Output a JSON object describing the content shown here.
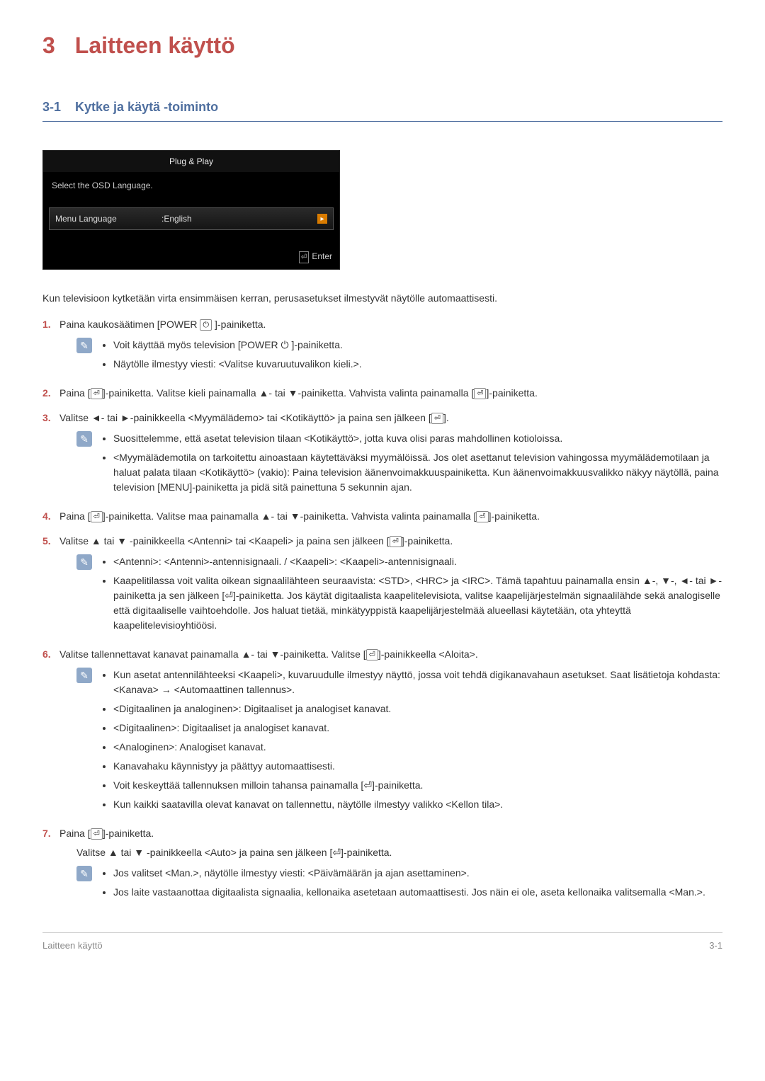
{
  "heading": {
    "num": "3",
    "title": "Laitteen käyttö"
  },
  "section": {
    "num": "3-1",
    "title": "Kytke ja käytä -toiminto"
  },
  "osd": {
    "title": "Plug & Play",
    "prompt": "Select the OSD Language.",
    "row_label": "Menu Language",
    "row_value": ":English",
    "enter_label": "Enter"
  },
  "intro": "Kun televisioon kytketään virta ensimmäisen kerran, perusasetukset ilmestyvät näytölle automaattisesti.",
  "glyphs": {
    "enter": "⏎",
    "power": "⏻",
    "up": "▲",
    "down": "▼",
    "left": "◄",
    "right": "►"
  },
  "steps": [
    {
      "text_parts": [
        "Paina kaukosäätimen [POWER ",
        "⏻",
        " ]-painiketta."
      ],
      "note": [
        "Voit käyttää myös television [POWER ⏻ ]-painiketta.",
        "Näytölle ilmestyy viesti: <Valitse kuvaruutuvalikon kieli.>."
      ]
    },
    {
      "text_parts": [
        "Paina [",
        "⏎",
        "]-painiketta. Valitse kieli painamalla ▲- tai ▼-painiketta. Vahvista valinta painamalla [",
        "⏎",
        "]-painiketta."
      ]
    },
    {
      "text_parts": [
        "Valitse ◄- tai ►-painikkeella <Myymälädemo> tai <Kotikäyttö> ja paina sen jälkeen [",
        "⏎",
        "]."
      ],
      "note": [
        "Suosittelemme, että asetat television tilaan <Kotikäyttö>, jotta kuva olisi paras mahdollinen kotioloissa.",
        "<Myymälädemotila on tarkoitettu ainoastaan käytettäväksi myymälöissä. Jos olet asettanut television vahingossa myymälädemotilaan ja haluat palata tilaan <Kotikäyttö> (vakio): Paina television äänenvoimakkuuspainiketta. Kun äänenvoimakkuusvalikko näkyy näytöllä, paina television [MENU]-painiketta ja pidä sitä painettuna 5 sekunnin ajan."
      ]
    },
    {
      "text_parts": [
        "Paina [",
        "⏎",
        "]-painiketta. Valitse maa painamalla ▲- tai ▼-painiketta. Vahvista valinta painamalla [",
        "⏎",
        "]-painiketta."
      ]
    },
    {
      "text_parts": [
        "Valitse ▲ tai ▼ -painikkeella <Antenni> tai <Kaapeli> ja paina sen jälkeen [",
        "⏎",
        "]-painiketta."
      ],
      "note": [
        "<Antenni>: <Antenni>-antennisignaali. / <Kaapeli>: <Kaapeli>-antennisignaali.",
        "Kaapelitilassa voit valita oikean signaalilähteen seuraavista: <STD>, <HRC> ja <IRC>. Tämä tapahtuu painamalla ensin ▲-, ▼-, ◄- tai ►-painiketta ja sen jälkeen [⏎]-painiketta. Jos käytät digitaalista kaapelitelevisiota, valitse kaapelijärjestelmän signaalilähde sekä analogiselle että digitaaliselle vaihtoehdolle. Jos haluat tietää, minkätyyppistä kaapelijärjestelmää alueellasi käytetään, ota yhteyttä kaapelitelevisioyhtiöösi."
      ]
    },
    {
      "text_parts": [
        "Valitse tallennettavat kanavat painamalla ▲- tai ▼-painiketta. Valitse [",
        "⏎",
        "]-painikkeella <Aloita>."
      ],
      "note": [
        "Kun asetat antennilähteeksi <Kaapeli>, kuvaruudulle ilmestyy näyttö, jossa voit tehdä digikanavahaun asetukset. Saat lisätietoja kohdasta: <Kanava> → <Automaattinen tallennus>.",
        "<Digitaalinen ja analoginen>: Digitaaliset ja analogiset kanavat.",
        "<Digitaalinen>: Digitaaliset ja analogiset kanavat.",
        "<Analoginen>: Analogiset kanavat.",
        "Kanavahaku käynnistyy ja päättyy automaattisesti.",
        "Voit keskeyttää tallennuksen milloin tahansa painamalla [⏎]-painiketta.",
        "Kun kaikki saatavilla olevat kanavat on tallennettu, näytölle ilmestyy valikko <Kellon tila>."
      ]
    },
    {
      "text_parts": [
        "Paina [",
        "⏎",
        "]-painiketta."
      ],
      "sub": "Valitse ▲ tai ▼ -painikkeella <Auto> ja paina sen jälkeen [⏎]-painiketta.",
      "note": [
        "Jos valitset <Man.>, näytölle ilmestyy viesti: <Päivämäärän ja ajan asettaminen>.",
        "Jos laite vastaanottaa digitaalista signaalia, kellonaika asetetaan automaattisesti. Jos näin ei ole, aseta kellonaika valitsemalla <Man.>."
      ]
    }
  ],
  "footer": {
    "left": "Laitteen käyttö",
    "right": "3-1"
  }
}
